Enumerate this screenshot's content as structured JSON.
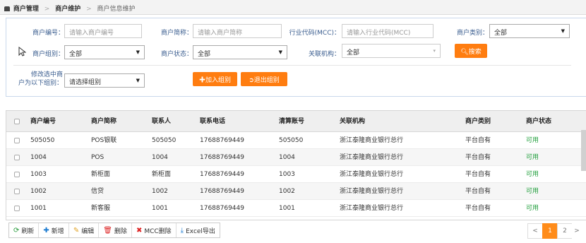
{
  "breadcrumb": {
    "items": [
      "商户管理",
      "商户维护",
      "商户信息维护"
    ]
  },
  "filters": {
    "merchant_no": {
      "label": "商户编号：",
      "placeholder": "请输入商户编号"
    },
    "merchant_abbr": {
      "label": "商户简称：",
      "placeholder": "请输入商户简称"
    },
    "mcc": {
      "label": "行业代码(MCC)：",
      "placeholder": "请输入行业代码(MCC)"
    },
    "merchant_type": {
      "label": "商户类别：",
      "value": "全部"
    },
    "merchant_group": {
      "label": "商户组别：",
      "value": "全部"
    },
    "merchant_status": {
      "label": "商户状态：",
      "value": "全部"
    },
    "related_org": {
      "label": "关联机构：",
      "value": "全部"
    },
    "search_button": "搜索",
    "modify_group": {
      "label_line1": "修改选中商",
      "label_line2": "户为以下组别：",
      "placeholder": "请选择组别"
    },
    "add_group_button": "加入组别",
    "exit_group_button": "退出组别"
  },
  "table": {
    "columns": [
      "商户编号",
      "商户简称",
      "联系人",
      "联系电话",
      "清算账号",
      "关联机构",
      "商户类别",
      "商户状态"
    ],
    "rows": [
      [
        "505050",
        "POS银联",
        "505050",
        "17688769449",
        "505050",
        "浙江泰隆商业银行总行",
        "平台自有",
        "可用"
      ],
      [
        "1004",
        "POS",
        "1004",
        "17688769449",
        "1004",
        "浙江泰隆商业银行总行",
        "平台自有",
        "可用"
      ],
      [
        "1003",
        "新柜面",
        "新柜面",
        "17688769449",
        "1003",
        "浙江泰隆商业银行总行",
        "平台自有",
        "可用"
      ],
      [
        "1002",
        "信贷",
        "1002",
        "17688769449",
        "1002",
        "浙江泰隆商业银行总行",
        "平台自有",
        "可用"
      ],
      [
        "1001",
        "新客服",
        "1001",
        "17688769449",
        "1001",
        "浙江泰隆商业银行总行",
        "平台自有",
        "可用"
      ]
    ]
  },
  "toolbar": {
    "refresh": "刷新",
    "add": "新增",
    "edit": "编辑",
    "delete": "删除",
    "mcc_delete": "MCC删除",
    "excel_export": "Excel导出"
  },
  "pagination": {
    "prev": "<",
    "pages": [
      "1",
      "2"
    ],
    "next": ">"
  },
  "colors": {
    "accent": "#ff7d10",
    "label": "#3a5d8f",
    "status_ok": "#1e9e3a"
  },
  "icons": [
    "home-icon",
    "search-icon",
    "plus-icon",
    "logout-icon",
    "refresh-icon",
    "add-icon",
    "pencil-icon",
    "trash-icon",
    "x-icon",
    "download-icon"
  ]
}
